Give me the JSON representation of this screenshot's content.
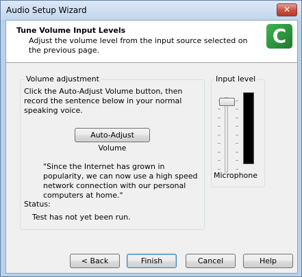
{
  "window": {
    "title": "Audio Setup Wizard",
    "close_glyph": "✕"
  },
  "header": {
    "title": "Tune Volume Input Levels",
    "description": "Adjust the volume level from the input source selected on the previous page.",
    "logo_icon": "camtasia-logo-icon",
    "logo_letter": "C"
  },
  "volume_group": {
    "label": "Volume adjustment",
    "instructions": "Click the Auto-Adjust Volume button, then record the sentence below in your normal speaking voice.",
    "auto_adjust_label": "Auto-Adjust Volume",
    "quote": "\"Since the Internet has grown in popularity, we can now use a high speed network connection with our personal computers at home.\"",
    "status_label": "Status:",
    "status_text": "Test has not yet been run."
  },
  "input_group": {
    "label": "Input level",
    "device_label": "Microphone"
  },
  "footer": {
    "back_label": "< Back",
    "finish_label": "Finish",
    "cancel_label": "Cancel",
    "help_label": "Help"
  },
  "colors": {
    "logo_green": "#2e9a3e",
    "meter_black": "#000000",
    "default_button_border": "#3c7fb1"
  }
}
